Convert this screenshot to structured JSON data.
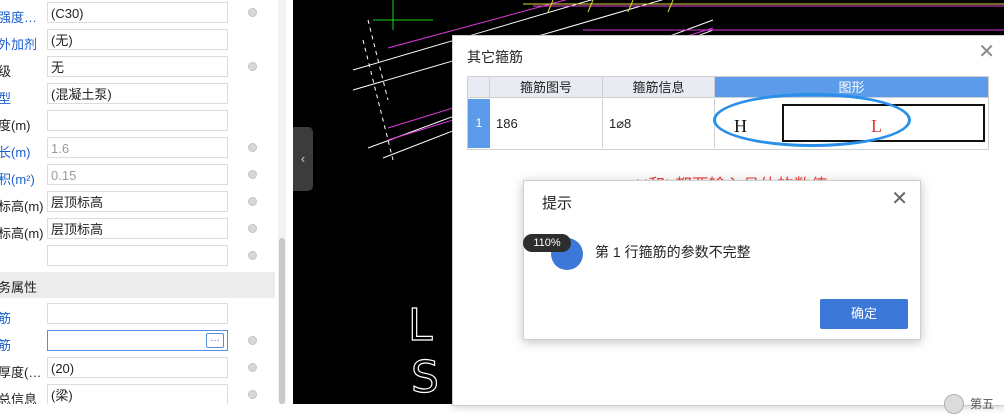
{
  "property_panel": {
    "rows": [
      {
        "label": "强度…",
        "value": "(C30)",
        "label_color": "blue",
        "value_style": "normal"
      },
      {
        "label": "外加剂",
        "value": "(无)",
        "label_color": "blue",
        "value_style": "normal"
      },
      {
        "label": "级",
        "value": "无",
        "label_color": "black",
        "value_style": "normal"
      },
      {
        "label": "型",
        "value": "(混凝土泵)",
        "label_color": "blue",
        "value_style": "normal"
      },
      {
        "label": "度(m)",
        "value": "",
        "label_color": "black",
        "value_style": "normal"
      },
      {
        "label": "长(m)",
        "value": "1.6",
        "label_color": "blue",
        "value_style": "gray"
      },
      {
        "label": "积(m²)",
        "value": "0.15",
        "label_color": "blue",
        "value_style": "gray"
      },
      {
        "label": "标高(m)",
        "value": "层顶标高",
        "label_color": "black",
        "value_style": "normal"
      },
      {
        "label": "标高(m)",
        "value": "层顶标高",
        "label_color": "black",
        "value_style": "normal"
      },
      {
        "label": "",
        "value": "",
        "label_color": "black",
        "value_style": "normal"
      }
    ],
    "section_title": "务属性",
    "rows2": [
      {
        "label": "筋",
        "value": "",
        "label_color": "blue"
      },
      {
        "label": "筋",
        "value": "",
        "label_color": "blue"
      },
      {
        "label": "厚度(…",
        "value": "(20)",
        "label_color": "black"
      },
      {
        "label": "总信息",
        "value": "(梁)",
        "label_color": "black"
      }
    ],
    "ellipsis_label": "…"
  },
  "collapse_tab": {
    "glyph": "‹"
  },
  "cad": {
    "text_fragments": [
      "L",
      "S"
    ]
  },
  "dialog": {
    "title": "其它箍筋",
    "close_glyph": "✕",
    "columns": [
      "箍筋图号",
      "箍筋信息",
      "图形"
    ],
    "rows": [
      {
        "num": "1",
        "shape_no": "186",
        "info": "1⌀8"
      }
    ],
    "shape_labels": {
      "h": "H",
      "l": "L"
    },
    "annotation": "H和L都要输入具体的数值。"
  },
  "hint": {
    "title": "提示",
    "close_glyph": "✕",
    "message": "第 1 行箍筋的参数不完整",
    "ok_label": "确定",
    "zoom": "110%"
  },
  "corner": {
    "text": "第五"
  }
}
